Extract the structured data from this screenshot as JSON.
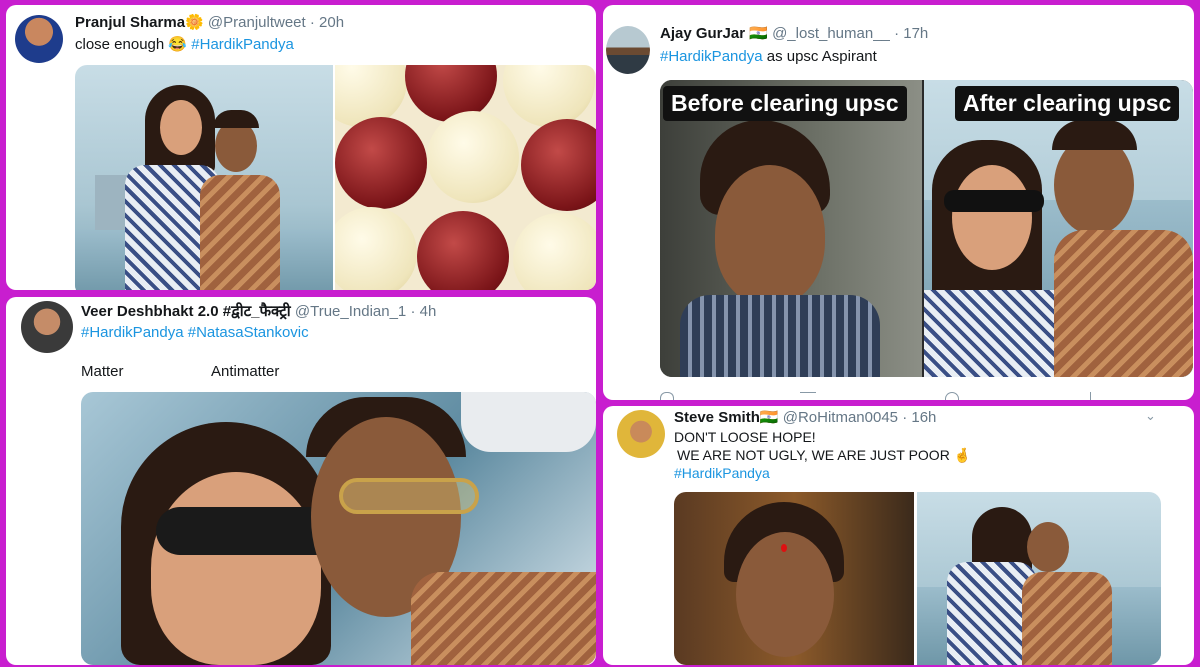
{
  "page": {
    "background": "#c81ecf"
  },
  "tweets": [
    {
      "id": "t1",
      "name": "Pranjul Sharma",
      "name_badge": "🌼",
      "handle": "@Pranjultweet",
      "dot": "·",
      "time": "20h",
      "text_plain": "close enough 😂",
      "hashtag": "#HardikPandya"
    },
    {
      "id": "t2",
      "name": "Ajay GurJar",
      "flag": "🇮🇳",
      "handle": "@_lost_human__",
      "dot": "·",
      "time": "17h",
      "hashtag": "#HardikPandya",
      "text_plain": "as upsc Aspirant",
      "meme_left": "Before clearing upsc",
      "meme_right": "After clearing upsc"
    },
    {
      "id": "t3",
      "name": "Veer Deshbhakt 2.0 #द्वीट_फैक्ट्री",
      "handle": "@True_Indian_1",
      "dot": "·",
      "time": "4h",
      "hashtag1": "#HardikPandya",
      "hashtag2": "#NatasaStankovic",
      "label_left": "Matter",
      "label_right": "Antimatter"
    },
    {
      "id": "t4",
      "name": "Steve Smith",
      "flag": "🇮🇳",
      "handle": "@RoHitman0045",
      "dot": "·",
      "time": "16h",
      "line1": "DON'T LOOSE HOPE!",
      "line2": "WE ARE NOT UGLY, WE ARE JUST POOR",
      "line2_emoji": "🤞",
      "hashtag": "#HardikPandya",
      "chevron": "⌄"
    }
  ]
}
